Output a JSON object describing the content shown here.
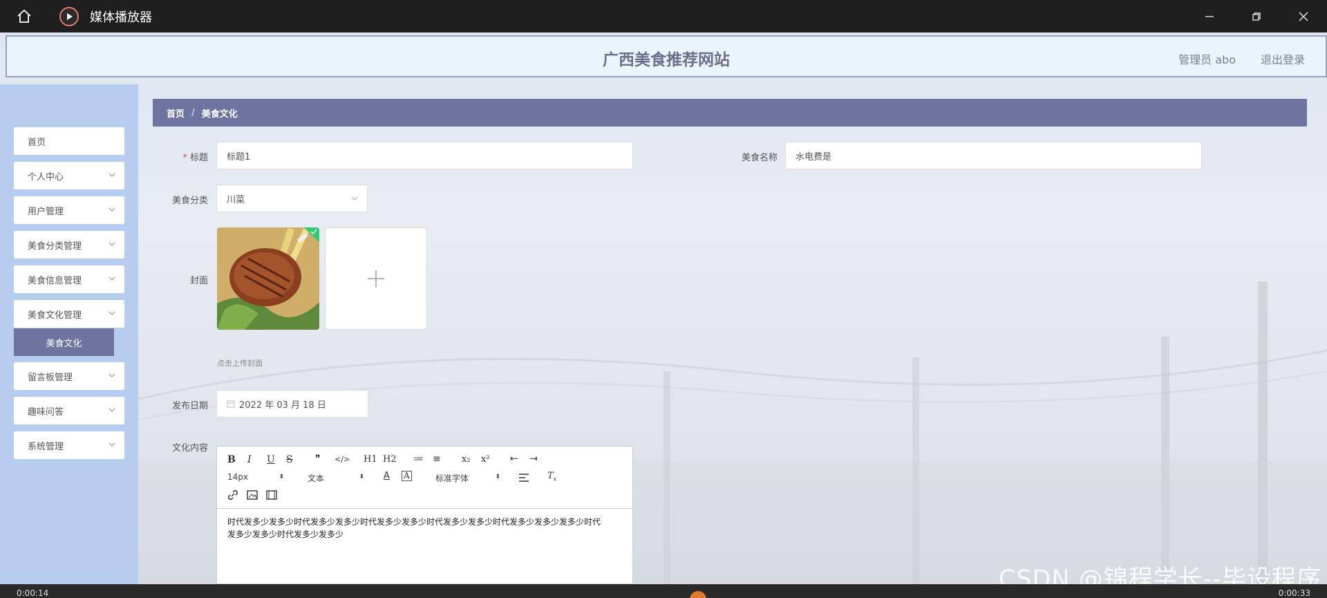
{
  "window": {
    "title": "媒体播放器",
    "icons": {
      "home": "home-icon",
      "logo": "play-icon",
      "minimize": "minimize-icon",
      "restore": "restore-icon",
      "close": "close-icon"
    }
  },
  "header": {
    "site_title": "广西美食推荐网站",
    "user_label": "管理员 abo",
    "logout": "退出登录"
  },
  "sidebar": {
    "items": [
      {
        "label": "首页"
      },
      {
        "label": "个人中心"
      },
      {
        "label": "用户管理"
      },
      {
        "label": "美食分类管理"
      },
      {
        "label": "美食信息管理"
      },
      {
        "label": "美食文化管理"
      },
      {
        "label": "留言板管理"
      },
      {
        "label": "趣味问答"
      },
      {
        "label": "系统管理"
      }
    ],
    "sub_item": "美食文化"
  },
  "breadcrumb": {
    "home": "首页",
    "separator": "/",
    "current": "美食文化"
  },
  "form": {
    "title_label": "标题",
    "title_value": "标题1",
    "food_name_label": "美食名称",
    "food_name_value": "水电费是",
    "category_label": "美食分类",
    "category_value": "川菜",
    "cover_label": "封面",
    "upload_hint": "点击上传封面",
    "date_label": "发布日期",
    "date_value": "2022 年 03 月 18 日",
    "content_label": "文化内容"
  },
  "editor": {
    "buttons": [
      "B",
      "I",
      "U",
      "S",
      "❞",
      "</>",
      "H1",
      "H2",
      "≔",
      "≡",
      "x₂",
      "x²",
      "⇤",
      "⇥"
    ],
    "font_size": "14px",
    "block_type": "文本",
    "font_family": "标准字体",
    "content": "时代发多少发多少时代发多少发多少时代发多少发多少时代发多少发多少时代发多少发多少发多少时代发多少发多少时代发多少发多少"
  },
  "watermark": "CSDN @锦程学长--毕设程序",
  "player": {
    "elapsed": "0:00:14",
    "total": "0:00:33"
  },
  "colors": {
    "accent": "#6f73a0",
    "sidebar_bg": "#b6cdf0",
    "header_bg": "#eaf4fd"
  }
}
